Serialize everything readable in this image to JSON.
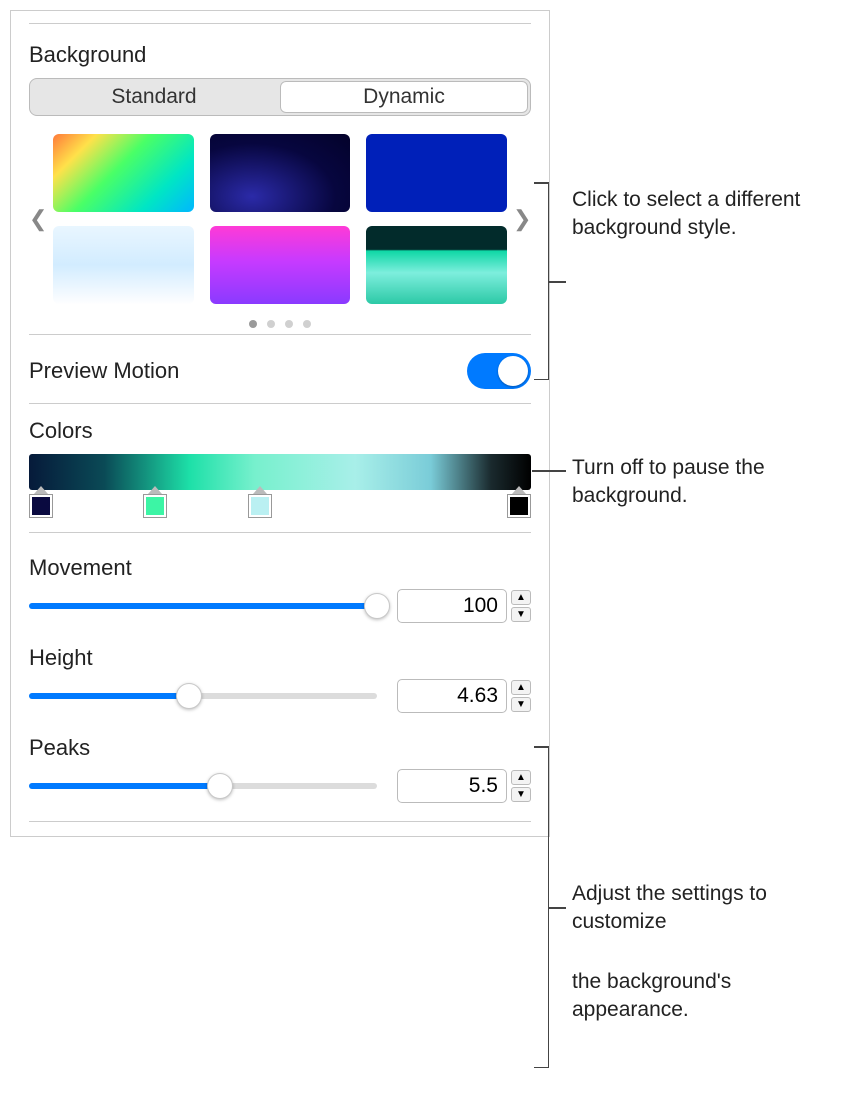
{
  "background": {
    "title": "Background",
    "tabs": {
      "standard": "Standard",
      "dynamic": "Dynamic",
      "active": "dynamic"
    },
    "pages": 4,
    "active_page": 0
  },
  "previewMotion": {
    "label": "Preview Motion",
    "on": true
  },
  "colors": {
    "title": "Colors",
    "stops": [
      {
        "hex": "#0a0a40"
      },
      {
        "hex": "#3cf5a5"
      },
      {
        "hex": "#baf0f2"
      },
      {
        "hex": "#000000"
      }
    ]
  },
  "sliders": {
    "movement": {
      "label": "Movement",
      "value": "100",
      "pct": 100
    },
    "height": {
      "label": "Height",
      "value": "4.63",
      "pct": 46
    },
    "peaks": {
      "label": "Peaks",
      "value": "5.5",
      "pct": 55
    }
  },
  "callouts": {
    "bgStyle": "Click to select a different background style.",
    "motion": "Turn off to pause the background.",
    "adjust1": "Adjust the settings to customize",
    "adjust2": "the background's appearance."
  }
}
